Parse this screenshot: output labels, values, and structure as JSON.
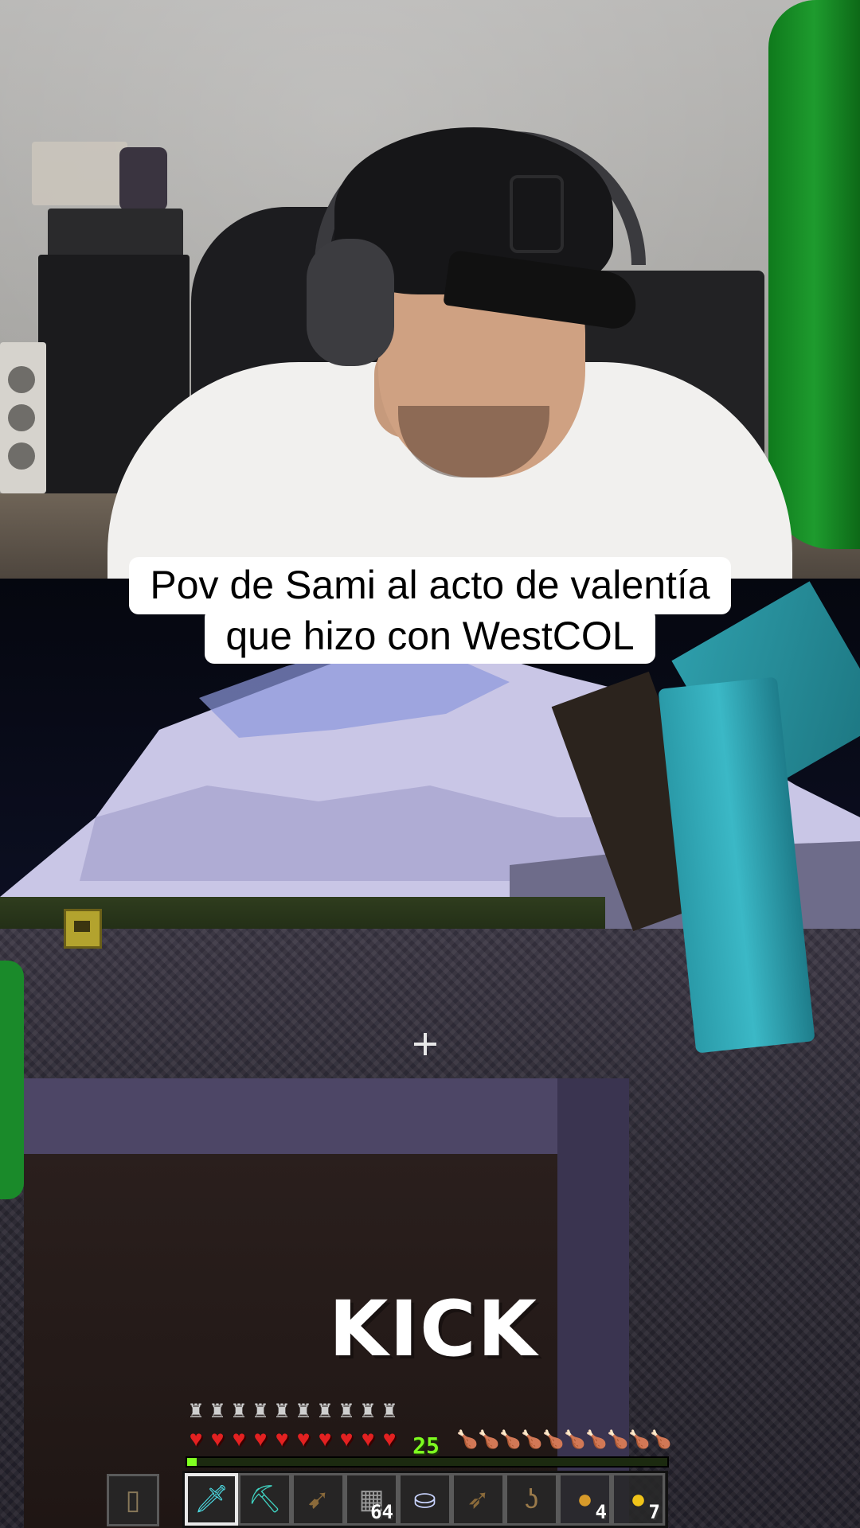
{
  "caption": {
    "line1": "Pov de Sami al acto de valentía",
    "line2": "que hizo con WestCOL"
  },
  "brand": {
    "logo_text": "KICK"
  },
  "game": {
    "hud": {
      "armor_points": 10,
      "hearts": 10,
      "hunger": 10,
      "level": "25",
      "xp_progress": 0.02,
      "offhand_item": "shield-icon",
      "selected_slot": 0,
      "hotbar": [
        {
          "item": "diamond-sword-icon",
          "glyph": "🗡",
          "count": ""
        },
        {
          "item": "diamond-pickaxe-icon",
          "glyph": "⛏",
          "count": ""
        },
        {
          "item": "bow-icon",
          "glyph": "➹",
          "count": ""
        },
        {
          "item": "cobblestone-icon",
          "glyph": "▦",
          "count": "64"
        },
        {
          "item": "water-bucket-icon",
          "glyph": "⛀",
          "count": ""
        },
        {
          "item": "crossbow-icon",
          "glyph": "➶",
          "count": ""
        },
        {
          "item": "fishing-rod-icon",
          "glyph": "ʖ",
          "count": ""
        },
        {
          "item": "bread-icon",
          "glyph": "●",
          "count": "4"
        },
        {
          "item": "golden-apple-icon",
          "glyph": "●",
          "count": "7"
        }
      ]
    }
  },
  "colors": {
    "caption_bg": "#ffffff",
    "heart": "#e32121",
    "xp": "#80ff20",
    "diamond": "#3bb8c6"
  }
}
